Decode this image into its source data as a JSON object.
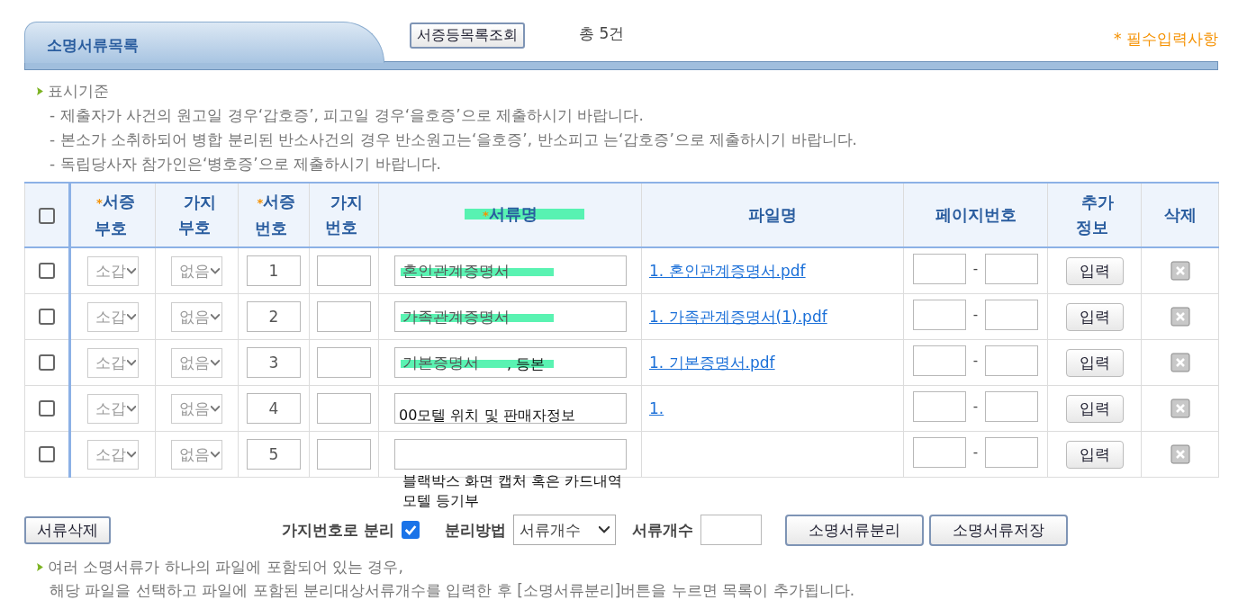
{
  "tab": {
    "title": "소명서류목록"
  },
  "list_button": "서증등목록조회",
  "total": "총 5건",
  "required_note": "* 필수입력사항",
  "criteria": {
    "title": "표시기준",
    "lines": [
      "- 제출자가 사건의 원고일 경우‘갑호증’, 피고일 경우‘을호증’으로 제출하시기 바랍니다.",
      "- 본소가 소취하되어 병합 분리된 반소사건의 경우 반소원고는‘을호증’, 반소피고 는‘갑호증’으로 제출하시기 바랍니다.",
      "- 독립당사자 참가인은‘병호증’으로 제출하시기 바랍니다."
    ]
  },
  "table": {
    "select_all_checked": false,
    "columns": [
      {
        "label": "서증\n부호",
        "required_mark": "*",
        "highlighted": false
      },
      {
        "label": "가지\n부호",
        "highlighted": false
      },
      {
        "label": "서증\n번호",
        "required_mark": "*",
        "highlighted": false
      },
      {
        "label": "가지\n번호",
        "highlighted": false
      },
      {
        "label": "서류명",
        "required_mark": "*",
        "highlighted": true
      },
      {
        "label": "파일명",
        "highlighted": false
      },
      {
        "label": "페이지번호",
        "highlighted": false
      },
      {
        "label": "추가\n정보",
        "highlighted": false
      },
      {
        "label": "삭제",
        "highlighted": false
      }
    ],
    "rows": [
      {
        "checked": false,
        "code": "소갑",
        "branch_code": "없음",
        "number": "1",
        "doc_name": "혼인관계증명서",
        "highlighted": true,
        "annotation": [],
        "file": "1. 혼인관계증명서.pdf",
        "page_separator": "-",
        "info_button": "입력"
      },
      {
        "checked": false,
        "code": "소갑",
        "branch_code": "없음",
        "number": "2",
        "doc_name": "가족관계증명서",
        "highlighted": true,
        "annotation": [],
        "file": "1. 가족관계증명서(1).pdf",
        "page_separator": "-",
        "info_button": "입력"
      },
      {
        "checked": false,
        "code": "소갑",
        "branch_code": "없음",
        "number": "3",
        "doc_name": "기본증명서",
        "highlighted": true,
        "annotation": [
          ", 등본"
        ],
        "file": "1. 기본증명서.pdf",
        "page_separator": "-",
        "info_button": "입력"
      },
      {
        "checked": false,
        "code": "소갑",
        "branch_code": "없음",
        "number": "4",
        "annotation": [
          "00모텔 위치 및 판매자정보"
        ],
        "file": "1.",
        "page_separator": "-",
        "info_button": "입력"
      },
      {
        "checked": false,
        "code": "소갑",
        "branch_code": "없음",
        "number": "5",
        "annotation": [
          "블랙박스 화면 캡처 혹은 카드내역",
          "모텔 등기부"
        ],
        "page_separator": "-",
        "info_button": "입력"
      }
    ]
  },
  "footer": {
    "delete_button": "서류삭제",
    "split_label": "가지번호로 분리",
    "split_checked": true,
    "method_label": "분리방법",
    "method_value": "서류개수",
    "count_label": "서류개수",
    "split_button": "소명서류분리",
    "save_button": "소명서류저장"
  },
  "note": {
    "lines": [
      "여러 소명서류가 하나의 파일에 포함되어 있는 경우,",
      "해당 파일을 선택하고 파일에 포함된 분리대상서류개수를 입력한 후 [소명서류분리]버튼을 누르면 목록이 추가됩니다."
    ]
  }
}
